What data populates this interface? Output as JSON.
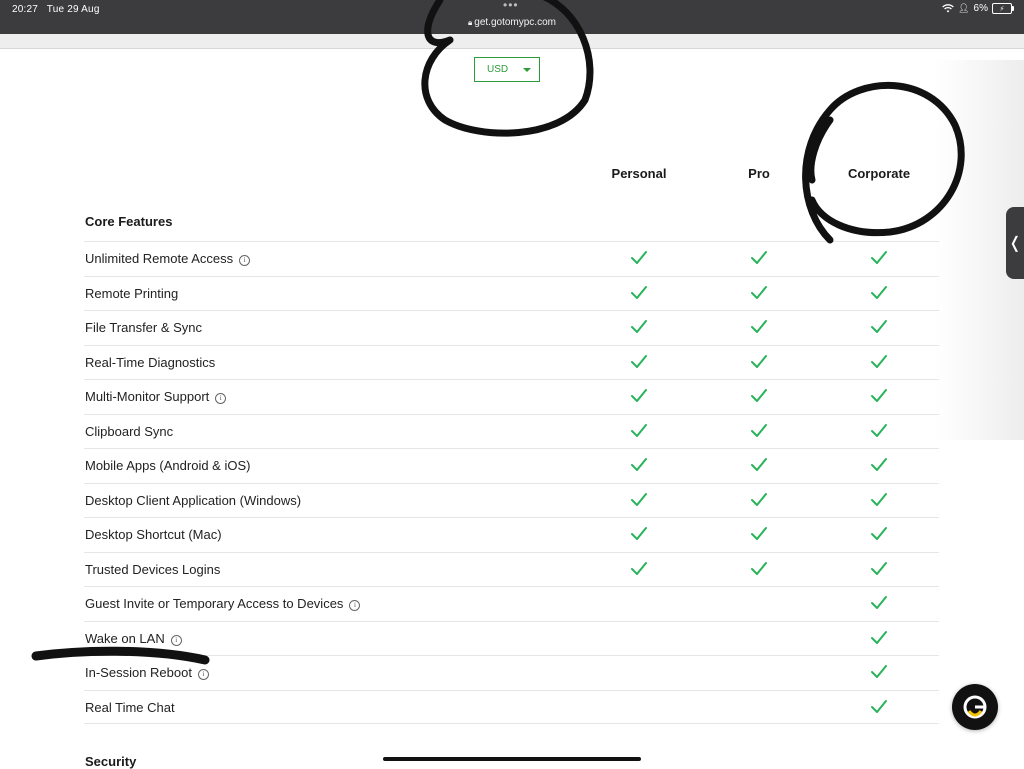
{
  "status_bar": {
    "time": "20:27",
    "date": "Tue 29 Aug",
    "url": "get.gotomypc.com",
    "battery": "6%"
  },
  "currency": {
    "selected": "USD"
  },
  "plans": {
    "personal": "Personal",
    "pro": "Pro",
    "corporate": "Corporate"
  },
  "sections": {
    "core": "Core Features",
    "security": "Security"
  },
  "features": [
    {
      "label": "Unlimited Remote Access",
      "info": true,
      "personal": true,
      "pro": true,
      "corporate": true
    },
    {
      "label": "Remote Printing",
      "info": false,
      "personal": true,
      "pro": true,
      "corporate": true
    },
    {
      "label": "File Transfer & Sync",
      "info": false,
      "personal": true,
      "pro": true,
      "corporate": true
    },
    {
      "label": "Real-Time Diagnostics",
      "info": false,
      "personal": true,
      "pro": true,
      "corporate": true
    },
    {
      "label": "Multi-Monitor Support",
      "info": true,
      "personal": true,
      "pro": true,
      "corporate": true
    },
    {
      "label": "Clipboard Sync",
      "info": false,
      "personal": true,
      "pro": true,
      "corporate": true
    },
    {
      "label": "Mobile Apps (Android & iOS)",
      "info": false,
      "personal": true,
      "pro": true,
      "corporate": true
    },
    {
      "label": "Desktop Client Application (Windows)",
      "info": false,
      "personal": true,
      "pro": true,
      "corporate": true
    },
    {
      "label": "Desktop Shortcut (Mac)",
      "info": false,
      "personal": true,
      "pro": true,
      "corporate": true
    },
    {
      "label": "Trusted Devices Logins",
      "info": false,
      "personal": true,
      "pro": true,
      "corporate": true
    },
    {
      "label": "Guest Invite or Temporary Access to Devices",
      "info": true,
      "personal": false,
      "pro": false,
      "corporate": true
    },
    {
      "label": "Wake on LAN",
      "info": true,
      "personal": false,
      "pro": false,
      "corporate": true
    },
    {
      "label": "In-Session Reboot",
      "info": true,
      "personal": false,
      "pro": false,
      "corporate": true
    },
    {
      "label": "Real Time Chat",
      "info": false,
      "personal": false,
      "pro": false,
      "corporate": true
    }
  ],
  "colors": {
    "check": "#27b35a",
    "accent": "#2d9b3a",
    "bar": "#3c3c3e"
  },
  "icons": {
    "info": "info-icon",
    "check": "check-icon",
    "chat": "g-chat-icon"
  }
}
